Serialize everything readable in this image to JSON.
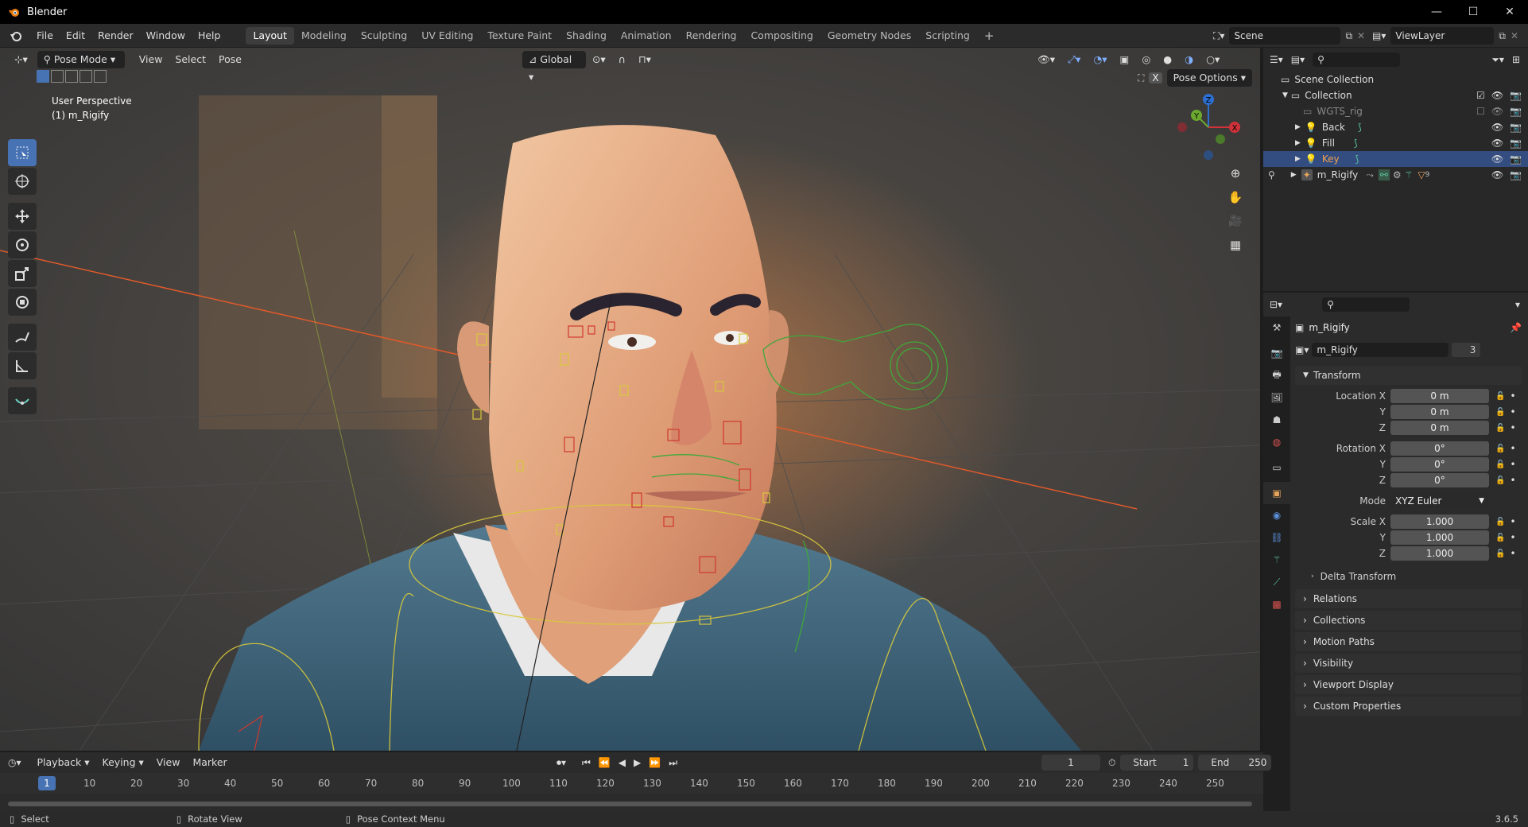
{
  "window": {
    "title": "Blender",
    "min": "—",
    "max": "☐",
    "close": "✕"
  },
  "menu": [
    "File",
    "Edit",
    "Render",
    "Window",
    "Help"
  ],
  "workspaces": [
    "Layout",
    "Modeling",
    "Sculpting",
    "UV Editing",
    "Texture Paint",
    "Shading",
    "Animation",
    "Rendering",
    "Compositing",
    "Geometry Nodes",
    "Scripting"
  ],
  "add_tab": "+",
  "scene": {
    "name": "Scene",
    "view_layer": "ViewLayer"
  },
  "viewport": {
    "mode": "Pose Mode",
    "menus": [
      "View",
      "Select",
      "Pose"
    ],
    "orientation": "Global",
    "pose_options": "Pose Options",
    "perspective": "User Perspective",
    "object_info": "(1) m_Rigify",
    "gizmo": {
      "x": "X",
      "y": "Y",
      "z": "Z"
    }
  },
  "outliner": {
    "root": "Scene Collection",
    "items": [
      {
        "label": "Collection"
      },
      {
        "label": "WGTS_rig"
      },
      {
        "label": "Back"
      },
      {
        "label": "Fill"
      },
      {
        "label": "Key"
      },
      {
        "label": "m_Rigify",
        "badge": "9"
      }
    ]
  },
  "properties": {
    "object_name": "m_Rigify",
    "data_name": "m_Rigify",
    "users": "3",
    "transform_label": "Transform",
    "location": {
      "label": "Location X",
      "x": "0 m",
      "y": "0 m",
      "z": "0 m"
    },
    "rotation": {
      "label": "Rotation X",
      "x": "0°",
      "y": "0°",
      "z": "0°"
    },
    "mode_label": "Mode",
    "mode_value": "XYZ Euler",
    "scale": {
      "label": "Scale X",
      "x": "1.000",
      "y": "1.000",
      "z": "1.000"
    },
    "axis": {
      "y": "Y",
      "z": "Z"
    },
    "delta": "Delta Transform",
    "panels": [
      "Relations",
      "Collections",
      "Motion Paths",
      "Visibility",
      "Viewport Display",
      "Custom Properties"
    ]
  },
  "timeline": {
    "menus": [
      "Playback",
      "Keying",
      "View",
      "Marker"
    ],
    "current_frame": "1",
    "start_label": "Start",
    "start": "1",
    "end_label": "End",
    "end": "250",
    "playhead": "1",
    "ticks": [
      "10",
      "20",
      "30",
      "40",
      "50",
      "60",
      "70",
      "80",
      "90",
      "100",
      "110",
      "120",
      "130",
      "140",
      "150",
      "160",
      "170",
      "180",
      "190",
      "200",
      "210",
      "220",
      "230",
      "240",
      "250"
    ]
  },
  "statusbar": {
    "select": "Select",
    "rotate": "Rotate View",
    "context": "Pose Context Menu",
    "version": "3.6.5"
  }
}
